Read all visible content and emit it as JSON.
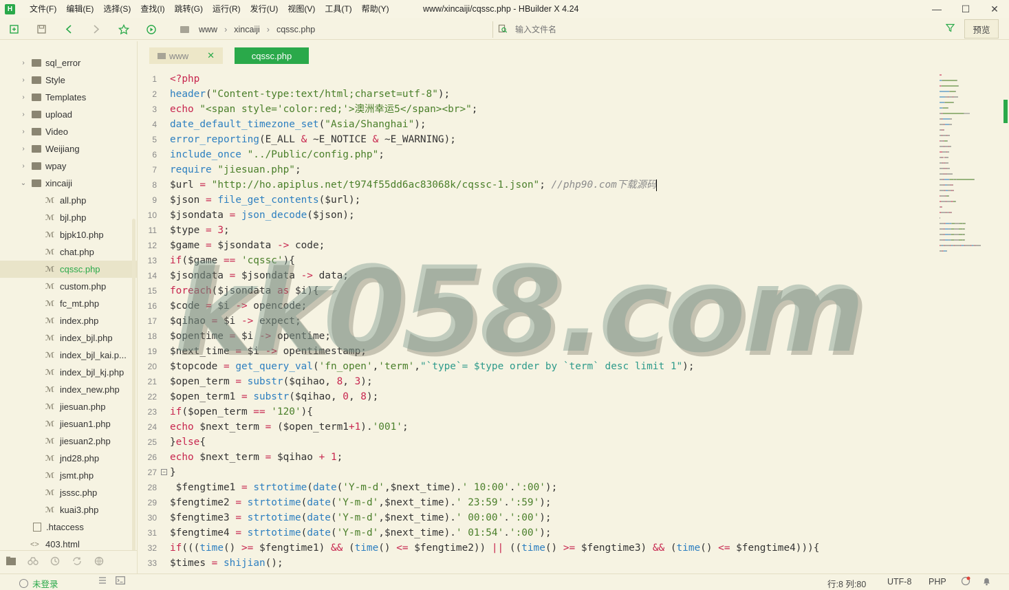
{
  "app": {
    "logo": "H",
    "window_title": "www/xincaiji/cqssc.php - HBuilder X 4.24"
  },
  "menu": [
    "文件(F)",
    "编辑(E)",
    "选择(S)",
    "查找(I)",
    "跳转(G)",
    "运行(R)",
    "发行(U)",
    "视图(V)",
    "工具(T)",
    "帮助(Y)"
  ],
  "window_controls": {
    "minimize": "—",
    "maximize": "☐",
    "close": "✕"
  },
  "toolbar": {
    "breadcrumb": [
      "www",
      "xincaiji",
      "cqssc.php"
    ],
    "file_search_placeholder": "输入文件名",
    "preview_label": "预览"
  },
  "sidebar": {
    "items": [
      {
        "type": "folder",
        "label": "sql_error",
        "arrow": "›"
      },
      {
        "type": "folder",
        "label": "Style",
        "arrow": "›"
      },
      {
        "type": "folder",
        "label": "Templates",
        "arrow": "›"
      },
      {
        "type": "folder",
        "label": "upload",
        "arrow": "›"
      },
      {
        "type": "folder",
        "label": "Video",
        "arrow": "›"
      },
      {
        "type": "folder",
        "label": "Weijiang",
        "arrow": "›"
      },
      {
        "type": "folder",
        "label": "wpay",
        "arrow": "›"
      },
      {
        "type": "folder-open",
        "label": "xincaiji",
        "arrow": "⌄"
      },
      {
        "type": "php",
        "label": "all.php"
      },
      {
        "type": "php",
        "label": "bjl.php"
      },
      {
        "type": "php",
        "label": "bjpk10.php"
      },
      {
        "type": "php",
        "label": "chat.php"
      },
      {
        "type": "php",
        "label": "cqssc.php",
        "selected": true
      },
      {
        "type": "php",
        "label": "custom.php"
      },
      {
        "type": "php",
        "label": "fc_mt.php"
      },
      {
        "type": "php",
        "label": "index.php"
      },
      {
        "type": "php",
        "label": "index_bjl.php"
      },
      {
        "type": "php",
        "label": "index_bjl_kai.p..."
      },
      {
        "type": "php",
        "label": "index_bjl_kj.php"
      },
      {
        "type": "php",
        "label": "index_new.php"
      },
      {
        "type": "php",
        "label": "jiesuan.php"
      },
      {
        "type": "php",
        "label": "jiesuan1.php"
      },
      {
        "type": "php",
        "label": "jiesuan2.php"
      },
      {
        "type": "php",
        "label": "jnd28.php"
      },
      {
        "type": "php",
        "label": "jsmt.php"
      },
      {
        "type": "php",
        "label": "jsssc.php"
      },
      {
        "type": "php",
        "label": "kuai3.php"
      },
      {
        "type": "file",
        "label": ".htaccess"
      },
      {
        "type": "html",
        "label": "403.html"
      }
    ]
  },
  "tabs": [
    {
      "label": "www",
      "active": false,
      "close": "✕"
    },
    {
      "label": "cqssc.php",
      "active": true
    }
  ],
  "editor": {
    "watermark": "kk058.com",
    "lines": [
      {
        "n": "1",
        "code": [
          [
            "tag",
            "<?php"
          ]
        ]
      },
      {
        "n": "2",
        "code": [
          [
            "fn",
            "header"
          ],
          [
            "",
            "("
          ],
          [
            "str",
            "\"Content-type:text/html;charset=utf-8\""
          ],
          [
            "",
            ");"
          ]
        ]
      },
      {
        "n": "3",
        "code": [
          [
            "kw",
            "echo"
          ],
          [
            "",
            " "
          ],
          [
            "str",
            "\"<span style='color:red;'>澳洲幸运5</span><br>\""
          ],
          [
            "",
            ";"
          ]
        ]
      },
      {
        "n": "4",
        "code": [
          [
            "fn",
            "date_default_timezone_set"
          ],
          [
            "",
            "("
          ],
          [
            "str",
            "\"Asia/Shanghai\""
          ],
          [
            "",
            ");"
          ]
        ]
      },
      {
        "n": "5",
        "code": [
          [
            "fn",
            "error_reporting"
          ],
          [
            "",
            "(E_ALL "
          ],
          [
            "op",
            "&"
          ],
          [
            "",
            " ~E_NOTICE "
          ],
          [
            "op",
            "&"
          ],
          [
            "",
            " ~E_WARNING);"
          ]
        ]
      },
      {
        "n": "6",
        "code": [
          [
            "fn",
            "include_once"
          ],
          [
            "",
            " "
          ],
          [
            "str",
            "\"../Public/config.php\""
          ],
          [
            "",
            ";"
          ]
        ]
      },
      {
        "n": "7",
        "code": [
          [
            "fn",
            "require"
          ],
          [
            "",
            " "
          ],
          [
            "str",
            "\"jiesuan.php\""
          ],
          [
            "",
            ";"
          ]
        ]
      },
      {
        "n": "8",
        "code": [
          [
            "",
            "$url "
          ],
          [
            "op",
            "="
          ],
          [
            "",
            " "
          ],
          [
            "str",
            "\"http://ho.apiplus.net/t974f55dd6ac83068k/cqssc-1.json\""
          ],
          [
            "",
            "; "
          ],
          [
            "cmt",
            "//php90.com下载源码"
          ]
        ],
        "caret": true
      },
      {
        "n": "9",
        "code": [
          [
            "",
            "$json "
          ],
          [
            "op",
            "="
          ],
          [
            "",
            " "
          ],
          [
            "fn",
            "file_get_contents"
          ],
          [
            "",
            "($url);"
          ]
        ]
      },
      {
        "n": "10",
        "code": [
          [
            "",
            "$jsondata "
          ],
          [
            "op",
            "="
          ],
          [
            "",
            " "
          ],
          [
            "fn",
            "json_decode"
          ],
          [
            "",
            "($json);"
          ]
        ]
      },
      {
        "n": "11",
        "code": [
          [
            "",
            "$type "
          ],
          [
            "op",
            "="
          ],
          [
            "",
            " "
          ],
          [
            "num",
            "3"
          ],
          [
            "",
            ";"
          ]
        ]
      },
      {
        "n": "12",
        "code": [
          [
            "",
            "$game "
          ],
          [
            "op",
            "="
          ],
          [
            "",
            " $jsondata "
          ],
          [
            "op",
            "->"
          ],
          [
            "",
            " code;"
          ]
        ]
      },
      {
        "n": "13",
        "code": [
          [
            "kw",
            "if"
          ],
          [
            "",
            "($game "
          ],
          [
            "op",
            "=="
          ],
          [
            "",
            " "
          ],
          [
            "str",
            "'cqssc'"
          ],
          [
            "",
            "){"
          ]
        ]
      },
      {
        "n": "14",
        "code": [
          [
            "",
            "$jsondata "
          ],
          [
            "op",
            "="
          ],
          [
            "",
            " $jsondata "
          ],
          [
            "op",
            "->"
          ],
          [
            "",
            " data;"
          ]
        ]
      },
      {
        "n": "15",
        "code": [
          [
            "kw",
            "foreach"
          ],
          [
            "",
            "($jsondata "
          ],
          [
            "kw",
            "as"
          ],
          [
            "",
            " $i){"
          ]
        ]
      },
      {
        "n": "16",
        "code": [
          [
            "",
            "$code "
          ],
          [
            "op",
            "="
          ],
          [
            "",
            " $i "
          ],
          [
            "op",
            "->"
          ],
          [
            "",
            " opencode;"
          ]
        ]
      },
      {
        "n": "17",
        "code": [
          [
            "",
            "$qihao "
          ],
          [
            "op",
            "="
          ],
          [
            "",
            " $i "
          ],
          [
            "op",
            "->"
          ],
          [
            "",
            " expect;"
          ]
        ]
      },
      {
        "n": "18",
        "code": [
          [
            "",
            "$opentime "
          ],
          [
            "op",
            "="
          ],
          [
            "",
            " $i "
          ],
          [
            "op",
            "->"
          ],
          [
            "",
            " opentime;"
          ]
        ]
      },
      {
        "n": "19",
        "code": [
          [
            "",
            "$next_time "
          ],
          [
            "op",
            "="
          ],
          [
            "",
            " $i "
          ],
          [
            "op",
            "->"
          ],
          [
            "",
            " opentimestamp;"
          ]
        ]
      },
      {
        "n": "20",
        "code": [
          [
            "",
            "$topcode "
          ],
          [
            "op",
            "="
          ],
          [
            "",
            " "
          ],
          [
            "fn",
            "get_query_val"
          ],
          [
            "",
            "("
          ],
          [
            "str",
            "'fn_open'"
          ],
          [
            "",
            ","
          ],
          [
            "str",
            "'term'"
          ],
          [
            "",
            ","
          ],
          [
            "str2",
            "\"`type`= $type order by `term` desc limit 1\""
          ],
          [
            "",
            ");"
          ]
        ]
      },
      {
        "n": "21",
        "code": [
          [
            "",
            "$open_term "
          ],
          [
            "op",
            "="
          ],
          [
            "",
            " "
          ],
          [
            "fn",
            "substr"
          ],
          [
            "",
            "($qihao, "
          ],
          [
            "num",
            "8"
          ],
          [
            "",
            ", "
          ],
          [
            "num",
            "3"
          ],
          [
            "",
            ");"
          ]
        ]
      },
      {
        "n": "22",
        "code": [
          [
            "",
            "$open_term1 "
          ],
          [
            "op",
            "="
          ],
          [
            "",
            " "
          ],
          [
            "fn",
            "substr"
          ],
          [
            "",
            "($qihao, "
          ],
          [
            "num",
            "0"
          ],
          [
            "",
            ", "
          ],
          [
            "num",
            "8"
          ],
          [
            "",
            ");"
          ]
        ]
      },
      {
        "n": "23",
        "code": [
          [
            "kw",
            "if"
          ],
          [
            "",
            "($open_term "
          ],
          [
            "op",
            "=="
          ],
          [
            "",
            " "
          ],
          [
            "str",
            "'120'"
          ],
          [
            "",
            "){"
          ]
        ]
      },
      {
        "n": "24",
        "code": [
          [
            "kw",
            "echo"
          ],
          [
            "",
            " $next_term "
          ],
          [
            "op",
            "="
          ],
          [
            "",
            " ($open_term1"
          ],
          [
            "op",
            "+"
          ],
          [
            "num",
            "1"
          ],
          [
            "",
            ")."
          ],
          [
            "str",
            "'001'"
          ],
          [
            "",
            ";"
          ]
        ]
      },
      {
        "n": "25",
        "code": [
          [
            "",
            "}"
          ],
          [
            "kw",
            "else"
          ],
          [
            "",
            "{"
          ]
        ]
      },
      {
        "n": "26",
        "code": [
          [
            "kw",
            "echo"
          ],
          [
            "",
            " $next_term "
          ],
          [
            "op",
            "="
          ],
          [
            "",
            " $qihao "
          ],
          [
            "op",
            "+"
          ],
          [
            "",
            " "
          ],
          [
            "num",
            "1"
          ],
          [
            "",
            ";"
          ]
        ]
      },
      {
        "n": "27",
        "code": [
          [
            "",
            "}"
          ]
        ],
        "fold": "−"
      },
      {
        "n": "28",
        "code": [
          [
            "",
            " $fengtime1 "
          ],
          [
            "op",
            "="
          ],
          [
            "",
            " "
          ],
          [
            "fn",
            "strtotime"
          ],
          [
            "",
            "("
          ],
          [
            "fn",
            "date"
          ],
          [
            "",
            "("
          ],
          [
            "str",
            "'Y-m-d'"
          ],
          [
            "",
            ",$next_time)."
          ],
          [
            "str",
            "' 10:00'"
          ],
          [
            "",
            "."
          ],
          [
            "str",
            "':00'"
          ],
          [
            "",
            ");"
          ]
        ]
      },
      {
        "n": "29",
        "code": [
          [
            "",
            "$fengtime2 "
          ],
          [
            "op",
            "="
          ],
          [
            "",
            " "
          ],
          [
            "fn",
            "strtotime"
          ],
          [
            "",
            "("
          ],
          [
            "fn",
            "date"
          ],
          [
            "",
            "("
          ],
          [
            "str",
            "'Y-m-d'"
          ],
          [
            "",
            ",$next_time)."
          ],
          [
            "str",
            "' 23:59'"
          ],
          [
            "",
            "."
          ],
          [
            "str",
            "':59'"
          ],
          [
            "",
            ");"
          ]
        ]
      },
      {
        "n": "30",
        "code": [
          [
            "",
            "$fengtime3 "
          ],
          [
            "op",
            "="
          ],
          [
            "",
            " "
          ],
          [
            "fn",
            "strtotime"
          ],
          [
            "",
            "("
          ],
          [
            "fn",
            "date"
          ],
          [
            "",
            "("
          ],
          [
            "str",
            "'Y-m-d'"
          ],
          [
            "",
            ",$next_time)."
          ],
          [
            "str",
            "' 00:00'"
          ],
          [
            "",
            "."
          ],
          [
            "str",
            "':00'"
          ],
          [
            "",
            ");"
          ]
        ]
      },
      {
        "n": "31",
        "code": [
          [
            "",
            "$fengtime4 "
          ],
          [
            "op",
            "="
          ],
          [
            "",
            " "
          ],
          [
            "fn",
            "strtotime"
          ],
          [
            "",
            "("
          ],
          [
            "fn",
            "date"
          ],
          [
            "",
            "("
          ],
          [
            "str",
            "'Y-m-d'"
          ],
          [
            "",
            ",$next_time)."
          ],
          [
            "str",
            "' 01:54'"
          ],
          [
            "",
            "."
          ],
          [
            "str",
            "':00'"
          ],
          [
            "",
            ");"
          ]
        ]
      },
      {
        "n": "32",
        "code": [
          [
            "kw",
            "if"
          ],
          [
            "",
            "((("
          ],
          [
            "fn",
            "time"
          ],
          [
            "",
            "() "
          ],
          [
            "op",
            ">="
          ],
          [
            "",
            " $fengtime1) "
          ],
          [
            "op",
            "&&"
          ],
          [
            "",
            " ("
          ],
          [
            "fn",
            "time"
          ],
          [
            "",
            "() "
          ],
          [
            "op",
            "<="
          ],
          [
            "",
            " $fengtime2)) "
          ],
          [
            "op",
            "||"
          ],
          [
            "",
            " (("
          ],
          [
            "fn",
            "time"
          ],
          [
            "",
            "() "
          ],
          [
            "op",
            ">="
          ],
          [
            "",
            " $fengtime3) "
          ],
          [
            "op",
            "&&"
          ],
          [
            "",
            " ("
          ],
          [
            "fn",
            "time"
          ],
          [
            "",
            "() "
          ],
          [
            "op",
            "<="
          ],
          [
            "",
            " $fengtime4))){"
          ]
        ]
      },
      {
        "n": "33",
        "code": [
          [
            "",
            "$times "
          ],
          [
            "op",
            "="
          ],
          [
            "",
            " "
          ],
          [
            "fn",
            "shijian"
          ],
          [
            "",
            "();"
          ]
        ]
      }
    ]
  },
  "status": {
    "login": "未登录",
    "position": "行:8  列:80",
    "encoding": "UTF-8",
    "language": "PHP"
  },
  "colors": {
    "accent": "#2aa94a",
    "background": "#f6f3e2",
    "keyword": "#c7254e",
    "function": "#2d7fc0",
    "string": "#4a7f2a"
  }
}
